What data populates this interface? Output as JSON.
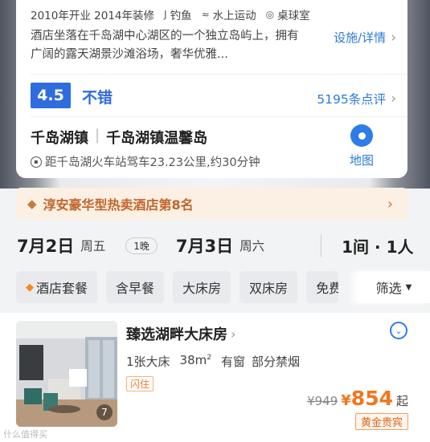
{
  "hotel": {
    "facilities": [
      {
        "icon": "",
        "label": "2010年开业 2014年装修"
      },
      {
        "icon": "fishing-icon",
        "label": "钓鱼"
      },
      {
        "icon": "water-sports-icon",
        "label": "水上运动"
      },
      {
        "icon": "billiards-icon",
        "label": "桌球室"
      }
    ],
    "description": "酒店坐落在千岛湖中心湖区的一个独立岛屿上，拥有广阔的露天湖景沙滩浴场，奢华优雅...",
    "facilities_link": "设施/详情",
    "rating": {
      "score": "4.5",
      "label": "不错",
      "reviews": "5195条点评"
    },
    "location": {
      "area": "千岛湖镇",
      "detail": "千岛湖镇温馨岛",
      "distance": "距千岛湖火车站驾车23.23公里,约30分钟",
      "map_label": "地图"
    }
  },
  "rank_banner": {
    "text": "淳安豪华型热卖酒店第8名"
  },
  "stay": {
    "checkin_date": "7月2日",
    "checkin_dow": "周五",
    "nights": "1晚",
    "checkout_date": "7月3日",
    "checkout_dow": "周六",
    "rooms_guests": "1间 · 1人"
  },
  "filters": {
    "chips": [
      "酒店套餐",
      "含早餐",
      "大床房",
      "双床房",
      "免费"
    ],
    "filter_label": "筛选"
  },
  "room": {
    "name": "臻选湖畔大床房",
    "bed": "1张大床",
    "area": "38m",
    "area_unit": "2",
    "window": "有窗",
    "smoking": "部分禁烟",
    "flash_badge": "闪住",
    "original_price": "¥949",
    "currency": "¥",
    "price": "854",
    "price_suffix": "起",
    "member_badge": "黄金贵宾",
    "image_count": "7"
  },
  "watermark": "什么值得买",
  "colors": {
    "accent_blue": "#2f6cde",
    "price_orange": "#f2761d",
    "rank_text": "#c0652a"
  }
}
